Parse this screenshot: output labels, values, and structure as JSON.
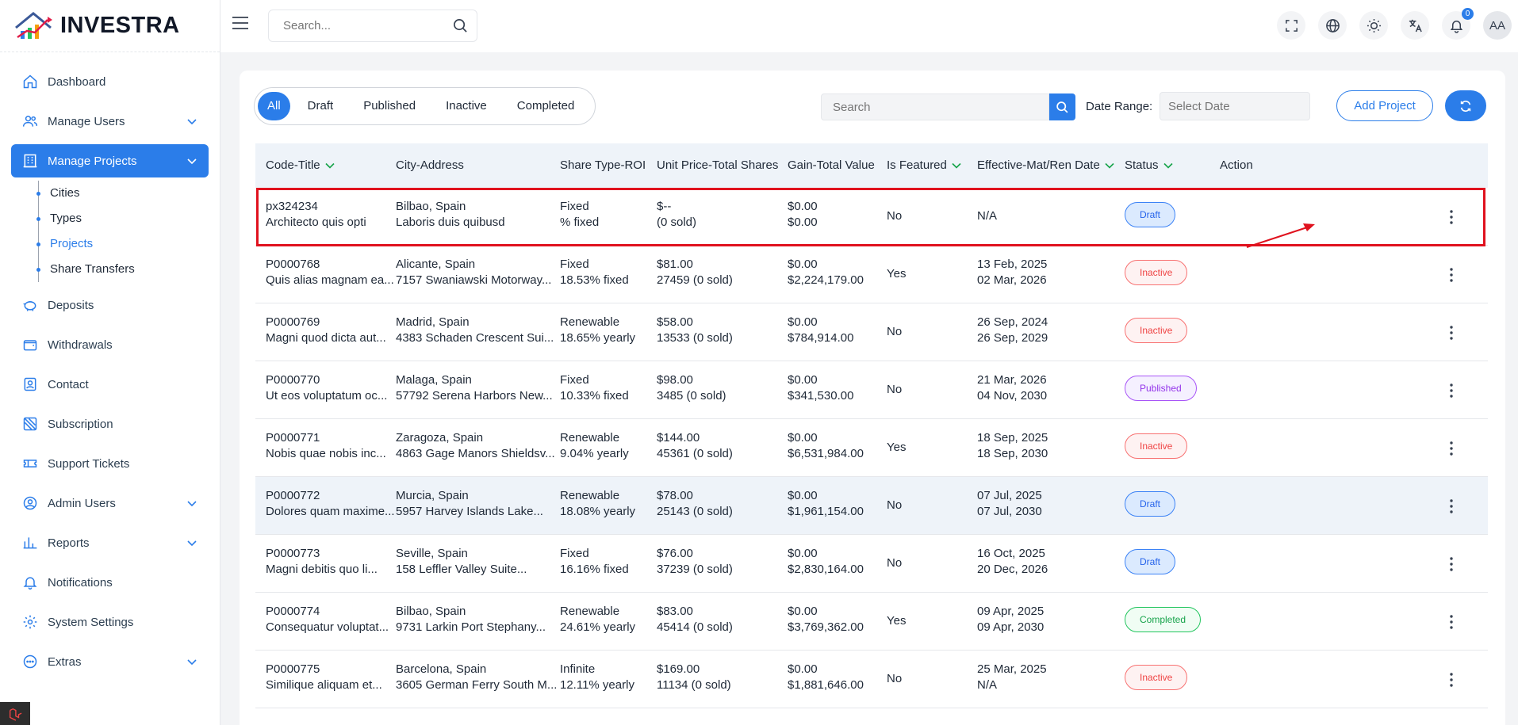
{
  "brand": {
    "name": "INVESTRA"
  },
  "topbar": {
    "search_placeholder": "Search...",
    "notification_count": "0",
    "avatar_initials": "AA"
  },
  "sidebar": {
    "items": [
      {
        "label": "Dashboard",
        "icon": "home-icon"
      },
      {
        "label": "Manage Users",
        "icon": "users-icon"
      },
      {
        "label": "Manage Projects",
        "icon": "building-icon"
      },
      {
        "label": "Deposits",
        "icon": "piggy-bank-icon"
      },
      {
        "label": "Withdrawals",
        "icon": "wallet-icon"
      },
      {
        "label": "Contact",
        "icon": "contact-icon"
      },
      {
        "label": "Subscription",
        "icon": "subscription-icon"
      },
      {
        "label": "Support Tickets",
        "icon": "ticket-icon"
      },
      {
        "label": "Admin Users",
        "icon": "admin-icon"
      },
      {
        "label": "Reports",
        "icon": "chart-icon"
      },
      {
        "label": "Notifications",
        "icon": "bell-icon"
      },
      {
        "label": "System Settings",
        "icon": "gear-icon"
      },
      {
        "label": "Extras",
        "icon": "more-icon"
      }
    ],
    "project_subitems": [
      "Cities",
      "Types",
      "Projects",
      "Share Transfers"
    ]
  },
  "filters": {
    "tabs": [
      "All",
      "Draft",
      "Published",
      "Inactive",
      "Completed"
    ],
    "search_placeholder": "Search",
    "date_label": "Date Range:",
    "date_placeholder": "Select Date",
    "add_label": "Add Project"
  },
  "table": {
    "headers": [
      "Code-Title",
      "City-Address",
      "Share Type-ROI",
      "Unit Price-Total Shares",
      "Gain-Total Value",
      "Is Featured",
      "Effective-Mat/Ren Date",
      "Status",
      "Action"
    ],
    "rows": [
      {
        "code": "px324234",
        "title": "Architecto quis opti",
        "city": "Bilbao, Spain",
        "address": "Laboris duis quibusd",
        "share_type": "Fixed",
        "roi": "% fixed",
        "unit_price": "$--",
        "total_shares": "(0 sold)",
        "gain": "$0.00",
        "total_value": "$0.00",
        "featured": "No",
        "date1": "N/A",
        "date2": "",
        "status": "Draft"
      },
      {
        "code": "P0000768",
        "title": "Quis alias magnam ea...",
        "city": "Alicante, Spain",
        "address": "7157 Swaniawski Motorway...",
        "share_type": "Fixed",
        "roi": "18.53% fixed",
        "unit_price": "$81.00",
        "total_shares": "27459 (0 sold)",
        "gain": "$0.00",
        "total_value": "$2,224,179.00",
        "featured": "Yes",
        "date1": "13 Feb, 2025",
        "date2": "02 Mar, 2026",
        "status": "Inactive"
      },
      {
        "code": "P0000769",
        "title": "Magni quod dicta aut...",
        "city": "Madrid, Spain",
        "address": "4383 Schaden Crescent Sui...",
        "share_type": "Renewable",
        "roi": "18.65% yearly",
        "unit_price": "$58.00",
        "total_shares": "13533 (0 sold)",
        "gain": "$0.00",
        "total_value": "$784,914.00",
        "featured": "No",
        "date1": "26 Sep, 2024",
        "date2": "26 Sep, 2029",
        "status": "Inactive"
      },
      {
        "code": "P0000770",
        "title": "Ut eos voluptatum oc...",
        "city": "Malaga, Spain",
        "address": "57792 Serena Harbors New...",
        "share_type": "Fixed",
        "roi": "10.33% fixed",
        "unit_price": "$98.00",
        "total_shares": "3485 (0 sold)",
        "gain": "$0.00",
        "total_value": "$341,530.00",
        "featured": "No",
        "date1": "21 Mar, 2026",
        "date2": "04 Nov, 2030",
        "status": "Published"
      },
      {
        "code": "P0000771",
        "title": "Nobis quae nobis inc...",
        "city": "Zaragoza, Spain",
        "address": "4863 Gage Manors Shieldsv...",
        "share_type": "Renewable",
        "roi": "9.04% yearly",
        "unit_price": "$144.00",
        "total_shares": "45361 (0 sold)",
        "gain": "$0.00",
        "total_value": "$6,531,984.00",
        "featured": "Yes",
        "date1": "18 Sep, 2025",
        "date2": "18 Sep, 2030",
        "status": "Inactive"
      },
      {
        "code": "P0000772",
        "title": "Dolores quam maxime...",
        "city": "Murcia, Spain",
        "address": "5957 Harvey Islands Lake...",
        "share_type": "Renewable",
        "roi": "18.08% yearly",
        "unit_price": "$78.00",
        "total_shares": "25143 (0 sold)",
        "gain": "$0.00",
        "total_value": "$1,961,154.00",
        "featured": "No",
        "date1": "07 Jul, 2025",
        "date2": "07 Jul, 2030",
        "status": "Draft"
      },
      {
        "code": "P0000773",
        "title": "Magni debitis quo li...",
        "city": "Seville, Spain",
        "address": "158 Leffler Valley Suite...",
        "share_type": "Fixed",
        "roi": "16.16% fixed",
        "unit_price": "$76.00",
        "total_shares": "37239 (0 sold)",
        "gain": "$0.00",
        "total_value": "$2,830,164.00",
        "featured": "No",
        "date1": "16 Oct, 2025",
        "date2": "20 Dec, 2026",
        "status": "Draft"
      },
      {
        "code": "P0000774",
        "title": "Consequatur voluptat...",
        "city": "Bilbao, Spain",
        "address": "9731 Larkin Port Stephany...",
        "share_type": "Renewable",
        "roi": "24.61% yearly",
        "unit_price": "$83.00",
        "total_shares": "45414 (0 sold)",
        "gain": "$0.00",
        "total_value": "$3,769,362.00",
        "featured": "Yes",
        "date1": "09 Apr, 2025",
        "date2": "09 Apr, 2030",
        "status": "Completed"
      },
      {
        "code": "P0000775",
        "title": "Similique aliquam et...",
        "city": "Barcelona, Spain",
        "address": "3605 German Ferry South M...",
        "share_type": "Infinite",
        "roi": "12.11% yearly",
        "unit_price": "$169.00",
        "total_shares": "11134 (0 sold)",
        "gain": "$0.00",
        "total_value": "$1,881,646.00",
        "featured": "No",
        "date1": "25 Mar, 2025",
        "date2": "N/A",
        "status": "Inactive"
      }
    ]
  },
  "colors": {
    "primary": "#2b7de9",
    "highlight": "#e0121e"
  }
}
